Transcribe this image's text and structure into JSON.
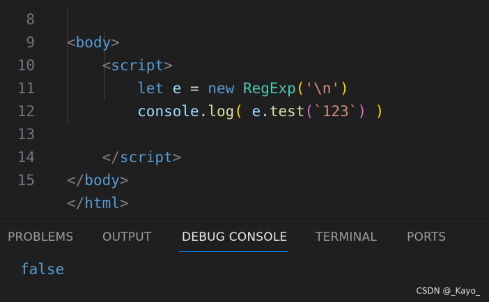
{
  "editor": {
    "lines": [
      {
        "number": "8",
        "tokens": [
          {
            "cls": "tok-punct",
            "text": "<"
          },
          {
            "cls": "tok-tag",
            "text": "body"
          },
          {
            "cls": "tok-punct",
            "text": ">"
          }
        ]
      },
      {
        "number": "9",
        "tokens": [
          {
            "cls": "tok-punct",
            "text": "    <"
          },
          {
            "cls": "tok-tag",
            "text": "script"
          },
          {
            "cls": "tok-punct",
            "text": ">"
          }
        ]
      },
      {
        "number": "10",
        "tokens": [
          {
            "cls": "tok-operator",
            "text": "        "
          },
          {
            "cls": "tok-keyword",
            "text": "let"
          },
          {
            "cls": "tok-operator",
            "text": " "
          },
          {
            "cls": "tok-variable",
            "text": "e"
          },
          {
            "cls": "tok-operator",
            "text": " = "
          },
          {
            "cls": "tok-keyword",
            "text": "new"
          },
          {
            "cls": "tok-operator",
            "text": " "
          },
          {
            "cls": "tok-class",
            "text": "RegExp"
          },
          {
            "cls": "tok-bracket1",
            "text": "("
          },
          {
            "cls": "tok-string",
            "text": "'\\n'"
          },
          {
            "cls": "tok-bracket1",
            "text": ")"
          }
        ]
      },
      {
        "number": "11",
        "tokens": [
          {
            "cls": "tok-operator",
            "text": "        "
          },
          {
            "cls": "tok-variable",
            "text": "console"
          },
          {
            "cls": "tok-operator",
            "text": "."
          },
          {
            "cls": "tok-method",
            "text": "log"
          },
          {
            "cls": "tok-bracket1",
            "text": "("
          },
          {
            "cls": "tok-operator",
            "text": " "
          },
          {
            "cls": "tok-variable",
            "text": "e"
          },
          {
            "cls": "tok-operator",
            "text": "."
          },
          {
            "cls": "tok-method",
            "text": "test"
          },
          {
            "cls": "tok-bracket2",
            "text": "("
          },
          {
            "cls": "tok-string",
            "text": "`123`"
          },
          {
            "cls": "tok-bracket2",
            "text": ")"
          },
          {
            "cls": "tok-operator",
            "text": " "
          },
          {
            "cls": "tok-bracket1",
            "text": ")"
          }
        ]
      },
      {
        "number": "12",
        "tokens": []
      },
      {
        "number": "13",
        "tokens": [
          {
            "cls": "tok-punct",
            "text": "    </"
          },
          {
            "cls": "tok-tag",
            "text": "script"
          },
          {
            "cls": "tok-punct",
            "text": ">"
          }
        ]
      },
      {
        "number": "14",
        "tokens": [
          {
            "cls": "tok-punct",
            "text": "</"
          },
          {
            "cls": "tok-tag",
            "text": "body"
          },
          {
            "cls": "tok-punct",
            "text": ">"
          }
        ]
      },
      {
        "number": "15",
        "tokens": [
          {
            "cls": "tok-punct",
            "text": "</"
          },
          {
            "cls": "tok-tag",
            "text": "html"
          },
          {
            "cls": "tok-punct",
            "text": ">"
          }
        ]
      }
    ]
  },
  "panel": {
    "tabs": [
      {
        "label": "PROBLEMS",
        "active": false
      },
      {
        "label": "OUTPUT",
        "active": false
      },
      {
        "label": "DEBUG CONSOLE",
        "active": true
      },
      {
        "label": "TERMINAL",
        "active": false
      },
      {
        "label": "PORTS",
        "active": false
      }
    ],
    "output": "false"
  },
  "watermark": "CSDN @_Kayo_",
  "colors": {
    "background": "#1f1f1f",
    "line_number": "#6e7681",
    "tag": "#569cd6",
    "keyword": "#569cd6",
    "variable": "#9cdcfe",
    "class": "#4ec9b0",
    "method": "#dcdcaa",
    "string": "#ce9178",
    "bracket_level1": "#ffd700",
    "bracket_level2": "#da70d6",
    "active_tab_underline": "#0078d4"
  }
}
